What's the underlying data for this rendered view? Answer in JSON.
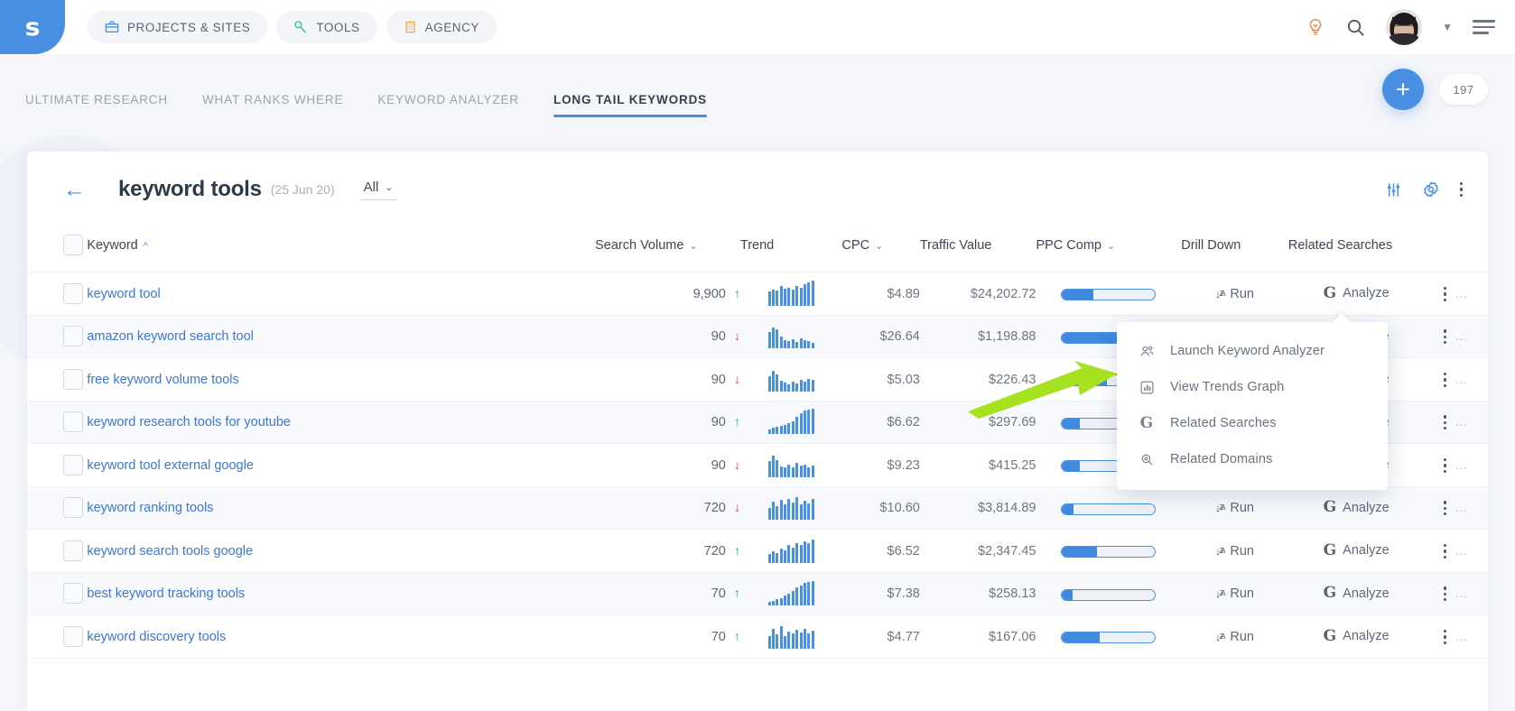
{
  "header": {
    "logo": "s",
    "nav_pills": [
      {
        "label": "PROJECTS & SITES",
        "icon": "briefcase-icon"
      },
      {
        "label": "TOOLS",
        "icon": "wrench-icon"
      },
      {
        "label": "AGENCY",
        "icon": "building-icon"
      }
    ],
    "icons": {
      "idea": "lightbulb-icon",
      "search": "search-icon",
      "avatar": "avatar",
      "chevron": "chevron-down-icon",
      "menu": "hamburger-menu-icon"
    }
  },
  "tabs": [
    {
      "label": "ULTIMATE RESEARCH",
      "active": false
    },
    {
      "label": "WHAT RANKS WHERE",
      "active": false
    },
    {
      "label": "KEYWORD ANALYZER",
      "active": false
    },
    {
      "label": "LONG TAIL KEYWORDS",
      "active": true
    }
  ],
  "tab_actions": {
    "add_label": "+",
    "count": "197"
  },
  "card": {
    "back": "←",
    "title": "keyword tools",
    "date": "(25 Jun 20)",
    "filter_label": "All",
    "filter_caret": "⌄",
    "tools": {
      "sliders": "sliders-icon",
      "settings": "gear-icon",
      "more": "kebab-menu-icon"
    }
  },
  "table": {
    "columns": [
      {
        "key": "checkbox",
        "label": ""
      },
      {
        "key": "keyword",
        "label": "Keyword",
        "sort": "^"
      },
      {
        "key": "search_volume",
        "label": "Search Volume",
        "sort": "⌄"
      },
      {
        "key": "trend",
        "label": "Trend"
      },
      {
        "key": "cpc",
        "label": "CPC",
        "sort": "⌄"
      },
      {
        "key": "traffic_value",
        "label": "Traffic Value"
      },
      {
        "key": "ppc_comp",
        "label": "PPC Comp",
        "sort": "⌄"
      },
      {
        "key": "drill_down",
        "label": "Drill Down"
      },
      {
        "key": "related_searches",
        "label": "Related Searches"
      }
    ],
    "action_run": "Run",
    "action_analyze": "Analyze",
    "rows": [
      {
        "keyword": "keyword tool",
        "search_volume": "9,900",
        "trend_dir": "up",
        "cpc": "$4.89",
        "traffic_value": "$24,202.72",
        "ppc_comp": 34,
        "spark": [
          52,
          60,
          58,
          72,
          62,
          68,
          60,
          74,
          66,
          80,
          88,
          92
        ]
      },
      {
        "keyword": "amazon keyword search tool",
        "search_volume": "90",
        "trend_dir": "down",
        "cpc": "$26.64",
        "traffic_value": "$1,198.88",
        "ppc_comp": 63,
        "spark": [
          60,
          78,
          70,
          44,
          30,
          26,
          34,
          22,
          36,
          30,
          26,
          20
        ]
      },
      {
        "keyword": "free keyword volume tools",
        "search_volume": "90",
        "trend_dir": "down",
        "cpc": "$5.03",
        "traffic_value": "$226.43",
        "ppc_comp": 48,
        "spark": [
          56,
          76,
          62,
          40,
          34,
          26,
          38,
          30,
          44,
          38,
          46,
          42
        ]
      },
      {
        "keyword": "keyword research tools for youtube",
        "search_volume": "90",
        "trend_dir": "up",
        "cpc": "$6.62",
        "traffic_value": "$297.69",
        "ppc_comp": 19,
        "spark": [
          18,
          22,
          26,
          30,
          34,
          40,
          48,
          62,
          76,
          86,
          90,
          92
        ]
      },
      {
        "keyword": "keyword tool external google",
        "search_volume": "90",
        "trend_dir": "down",
        "cpc": "$9.23",
        "traffic_value": "$415.25",
        "ppc_comp": 19,
        "spark": [
          60,
          80,
          64,
          40,
          36,
          48,
          38,
          52,
          42,
          46,
          38,
          44
        ]
      },
      {
        "keyword": "keyword ranking tools",
        "search_volume": "720",
        "trend_dir": "down",
        "cpc": "$10.60",
        "traffic_value": "$3,814.89",
        "ppc_comp": 12,
        "spark": [
          42,
          66,
          50,
          74,
          58,
          78,
          62,
          82,
          56,
          70,
          60,
          76
        ]
      },
      {
        "keyword": "keyword search tools google",
        "search_volume": "720",
        "trend_dir": "up",
        "cpc": "$6.52",
        "traffic_value": "$2,347.45",
        "ppc_comp": 38,
        "spark": [
          34,
          42,
          38,
          52,
          46,
          66,
          58,
          72,
          68,
          80,
          74,
          86
        ]
      },
      {
        "keyword": "best keyword tracking tools",
        "search_volume": "70",
        "trend_dir": "up",
        "cpc": "$7.38",
        "traffic_value": "$258.13",
        "ppc_comp": 11,
        "spark": [
          14,
          18,
          22,
          28,
          36,
          44,
          54,
          66,
          74,
          82,
          86,
          90
        ]
      },
      {
        "keyword": "keyword discovery tools",
        "search_volume": "70",
        "trend_dir": "up",
        "cpc": "$4.77",
        "traffic_value": "$167.06",
        "ppc_comp": 40,
        "spark": [
          46,
          72,
          54,
          84,
          48,
          62,
          56,
          70,
          60,
          74,
          58,
          66
        ]
      }
    ]
  },
  "context_menu": {
    "items": [
      {
        "label": "Launch Keyword Analyzer",
        "icon": "people-icon"
      },
      {
        "label": "View Trends Graph",
        "icon": "bar-chart-icon"
      },
      {
        "label": "Related Searches",
        "icon": "google-g-icon"
      },
      {
        "label": "Related Domains",
        "icon": "search-magnifier-icon"
      }
    ]
  },
  "annotation": {
    "arrow_color": "#a6e220",
    "points_to": "View Trends Graph"
  }
}
